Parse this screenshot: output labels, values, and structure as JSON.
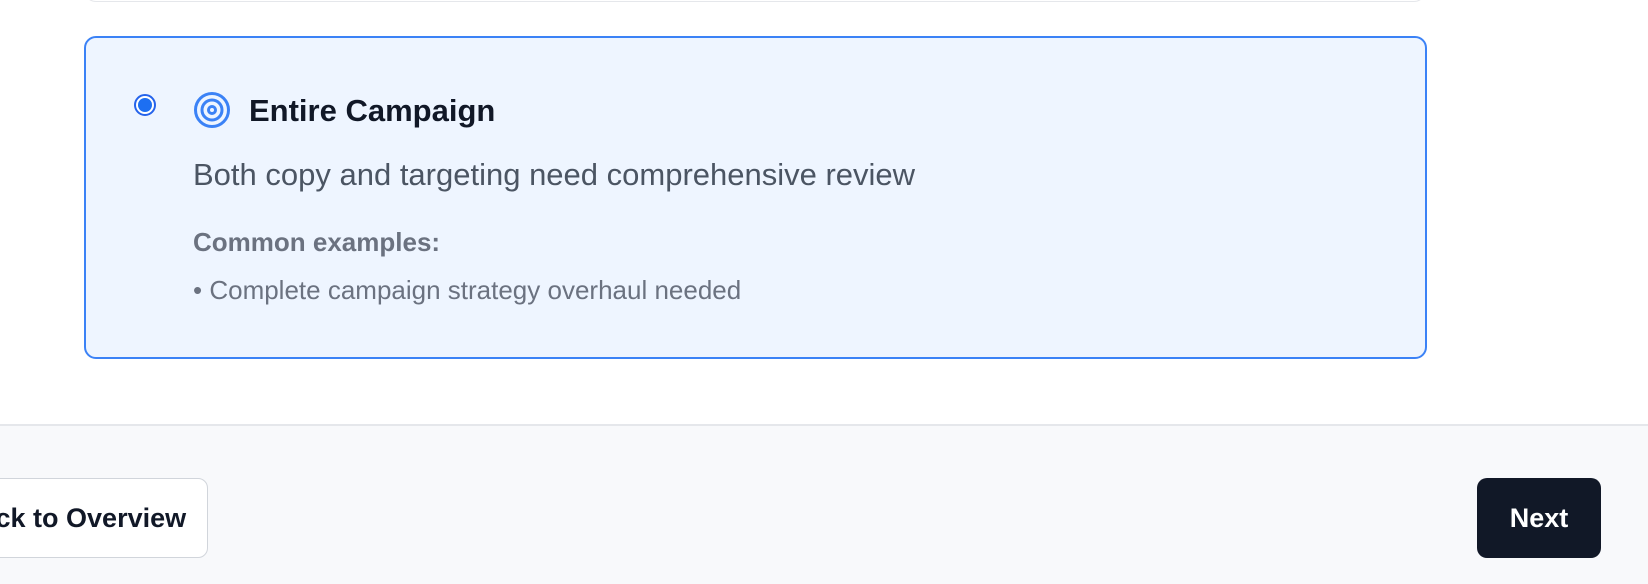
{
  "option": {
    "selected": true,
    "icon": "target-icon",
    "title": "Entire Campaign",
    "description": "Both copy and targeting need comprehensive review",
    "examples_heading": "Common examples:",
    "examples": [
      "• Complete campaign strategy overhaul needed"
    ]
  },
  "footer": {
    "back_label": "Back to Overview",
    "next_label": "Next"
  },
  "colors": {
    "accent": "#3b82f6",
    "selected_bg": "#eef5ff",
    "primary_button": "#111827"
  }
}
